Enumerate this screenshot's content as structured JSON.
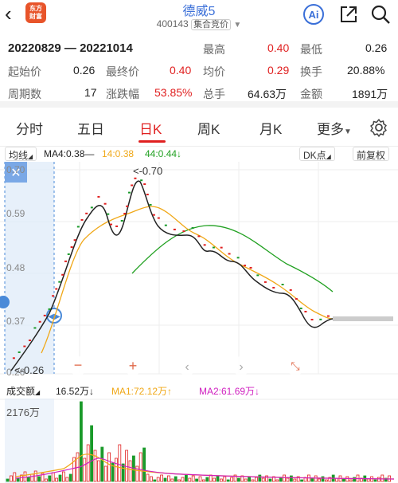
{
  "header": {
    "back_icon": "chevron-left-icon",
    "logo_text_1": "东方",
    "logo_text_2": "财富",
    "title": "德威5",
    "code": "400143",
    "auction_badge": "集合竞价",
    "ai_label": "Ai",
    "share_icon": "share-icon",
    "search_icon": "search-icon"
  },
  "stats": {
    "date_range": "20220829 — 20221014",
    "high_label": "最高",
    "high_value": "0.40",
    "low_label": "最低",
    "low_value": "0.26",
    "start_label": "起始价",
    "start_value": "0.26",
    "end_label": "最终价",
    "end_value": "0.40",
    "avg_label": "均价",
    "avg_value": "0.29",
    "turnover_label": "换手",
    "turnover_value": "20.88%",
    "days_label": "周期数",
    "days_value": "17",
    "change_label": "涨跌幅",
    "change_value": "53.85%",
    "volume_label": "总手",
    "volume_value": "64.63万",
    "amount_label": "金额",
    "amount_value": "1891万"
  },
  "tabs": [
    {
      "label": "分时"
    },
    {
      "label": "五日"
    },
    {
      "label": "日K"
    },
    {
      "label": "周K"
    },
    {
      "label": "月K"
    },
    {
      "label": "更多"
    }
  ],
  "active_tab": "日K",
  "ma_bar": {
    "indicator_label": "均线",
    "ma4": "MA4:0.38—",
    "ma14": "14:0.38",
    "ma44": "44:0.44↓",
    "dk_label": "DK点",
    "adjust_label": "前复权"
  },
  "chart": {
    "y_labels": [
      "0.70",
      "0.59",
      "0.48",
      "0.37",
      "0.26"
    ],
    "max_annotation": "<-0.70",
    "min_annotation": "<-0.26"
  },
  "volume_bar": {
    "label": "成交额",
    "value": "16.52万↓",
    "ma1": "MA1:72.12万↑",
    "ma2": "MA2:61.69万↓",
    "max_label": "2176万"
  },
  "colors": {
    "up": "#e02020",
    "down": "#1a9a2a",
    "ma4": "#222222",
    "ma14": "#f0a818",
    "ma44": "#20a020",
    "ma2": "#d020c0"
  }
}
